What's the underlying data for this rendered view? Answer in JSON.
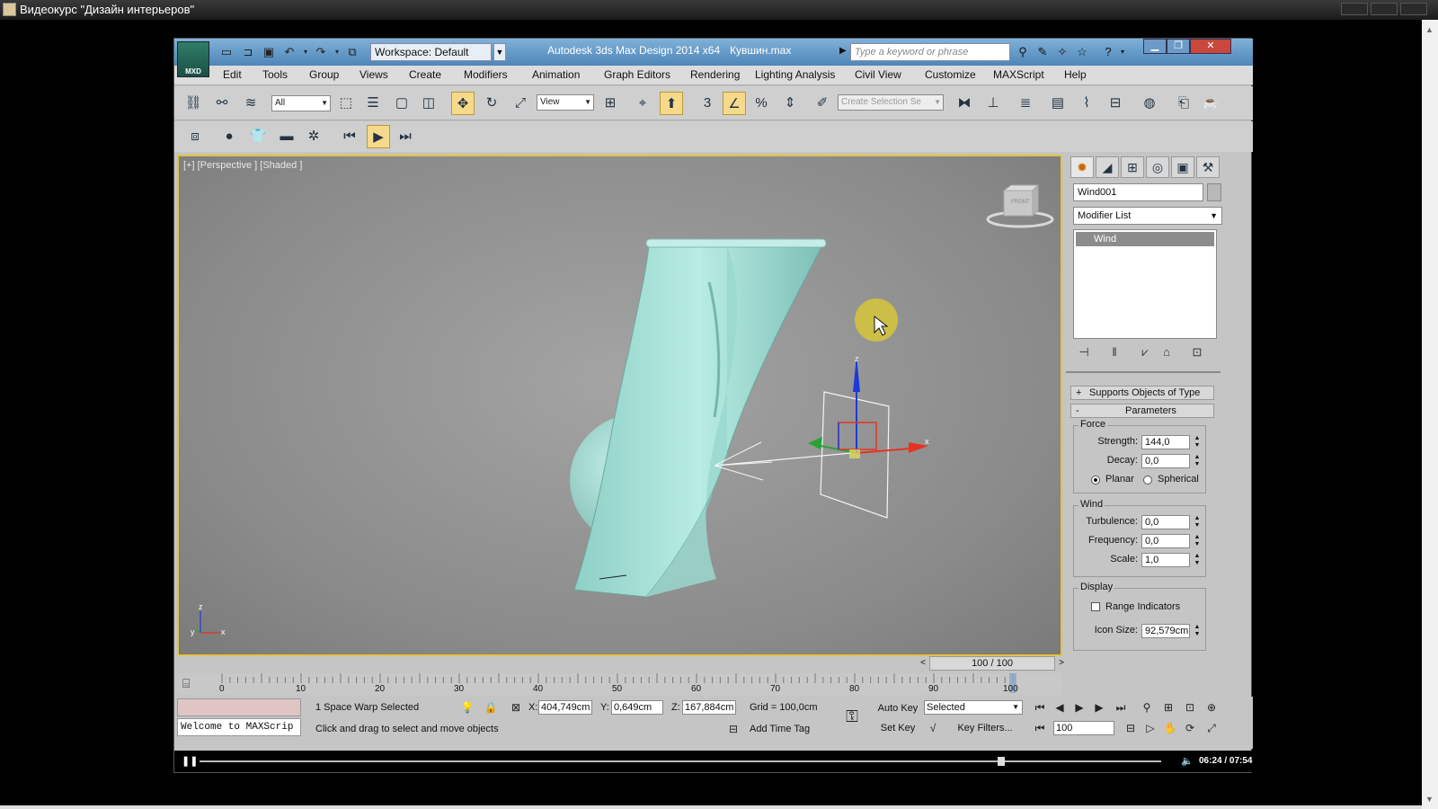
{
  "outer_window": {
    "title": "Видеокурс \"Дизайн интерьеров\""
  },
  "titlebar": {
    "logo_text": "MXD",
    "workspace": "Workspace: Default",
    "app_title": "Autodesk 3ds Max Design 2014 x64",
    "file_name": "Кувшин.max",
    "search_placeholder": "Type a keyword or phrase"
  },
  "menu": [
    "Edit",
    "Tools",
    "Group",
    "Views",
    "Create",
    "Modifiers",
    "Animation",
    "Graph Editors",
    "Rendering",
    "Lighting Analysis",
    "Civil View",
    "Customize",
    "MAXScript",
    "Help"
  ],
  "toolbar": {
    "selection_filter": "All",
    "ref_coord": "View",
    "named_selection_placeholder": "Create Selection Se",
    "snap_label": "3"
  },
  "viewport": {
    "label": "[+] [Perspective ] [Shaded ]",
    "viewcube_label": "FRONT",
    "axis_labels": [
      "z",
      "y",
      "x"
    ]
  },
  "command_panel": {
    "object_name": "Wind001",
    "modifier_list": "Modifier List",
    "stack_items": [
      "Wind"
    ],
    "rollouts": {
      "supports": "Supports Objects of Type",
      "parameters": "Parameters"
    },
    "force": {
      "title": "Force",
      "strength_label": "Strength:",
      "strength": "144,0",
      "decay_label": "Decay:",
      "decay": "0,0",
      "planar": "Planar",
      "spherical": "Spherical",
      "selected": "Planar"
    },
    "wind": {
      "title": "Wind",
      "turbulence_label": "Turbulence:",
      "turbulence": "0,0",
      "frequency_label": "Frequency:",
      "frequency": "0,0",
      "scale_label": "Scale:",
      "scale": "1,0"
    },
    "display": {
      "title": "Display",
      "range_indicators": "Range Indicators",
      "range_indicators_checked": false,
      "icon_size_label": "Icon Size:",
      "icon_size": "92,579cm"
    }
  },
  "timeline": {
    "slider_label": "100 / 100",
    "current_frame": 100,
    "tick_labels": [
      "0",
      "10",
      "20",
      "30",
      "40",
      "50",
      "60",
      "70",
      "80",
      "90",
      "100"
    ]
  },
  "status": {
    "maxscript": "Welcome to MAXScrip",
    "selection": "1 Space Warp Selected",
    "prompt": "Click and drag to select and move objects",
    "x_label": "X:",
    "x": "404,749cm",
    "y_label": "Y:",
    "y": "0,649cm",
    "z_label": "Z:",
    "z": "167,884cm",
    "grid": "Grid = 100,0cm",
    "add_time_tag": "Add Time Tag",
    "auto_key": "Auto Key",
    "set_key": "Set Key",
    "key_mode": "Selected",
    "key_filters": "Key Filters...",
    "frame_field": "100"
  },
  "video": {
    "time": "06:24 / 07:54",
    "progress": 0.83
  },
  "colors": {
    "accent": "#e3c341",
    "mesh": "#a6e0d8",
    "titlebar": "#5a8fbf"
  }
}
